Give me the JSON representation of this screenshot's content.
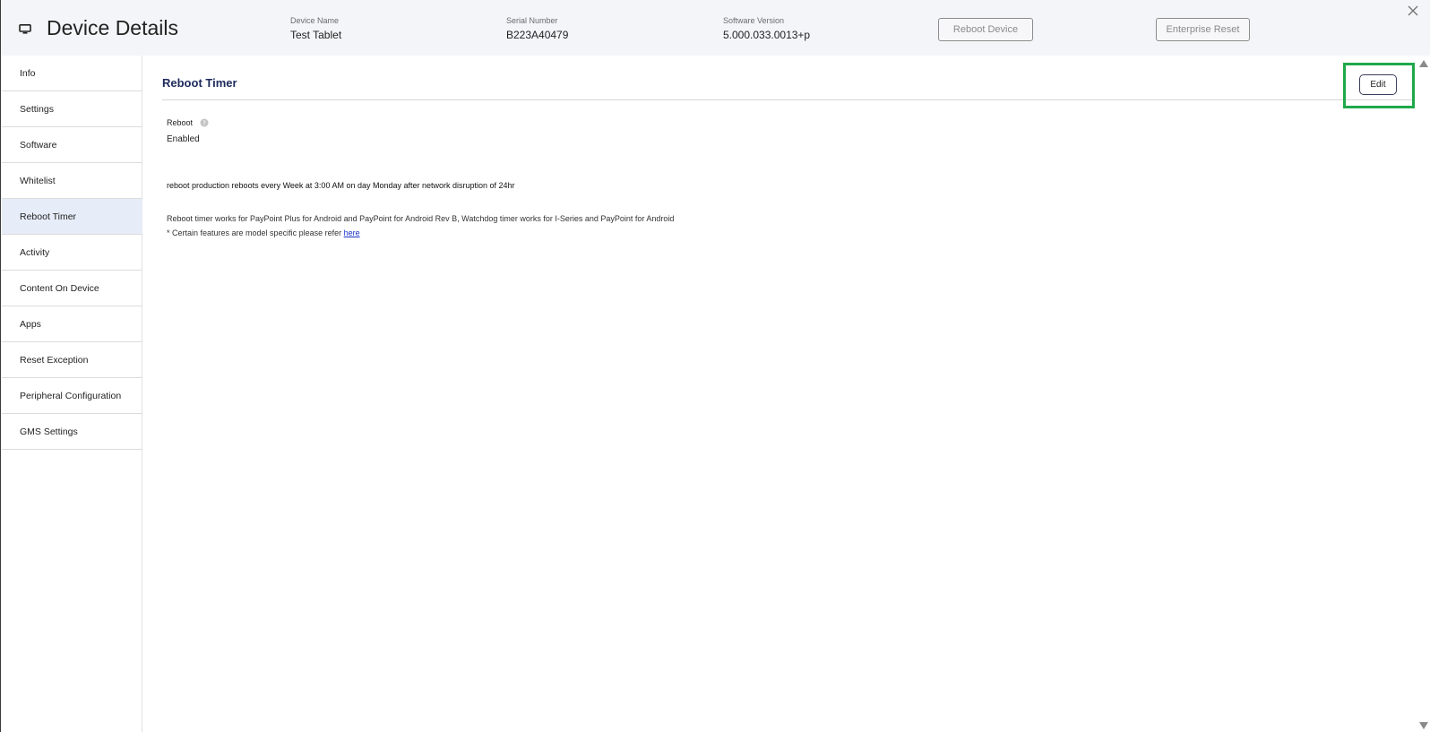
{
  "header": {
    "icon": "monitor-icon",
    "title": "Device Details",
    "device_name_label": "Device Name",
    "device_name": "Test Tablet",
    "serial_label": "Serial Number",
    "serial": "B223A40479",
    "software_label": "Software Version",
    "software": "5.000.033.0013+p",
    "reboot_button": "Reboot Device",
    "enterprise_button": "Enterprise Reset",
    "close_icon": "close-icon"
  },
  "sidebar": {
    "items": [
      {
        "label": "Info"
      },
      {
        "label": "Settings"
      },
      {
        "label": "Software"
      },
      {
        "label": "Whitelist"
      },
      {
        "label": "Reboot Timer",
        "active": true
      },
      {
        "label": "Activity"
      },
      {
        "label": "Content On Device"
      },
      {
        "label": "Apps"
      },
      {
        "label": "Reset Exception"
      },
      {
        "label": "Peripheral Configuration"
      },
      {
        "label": "GMS Settings"
      }
    ]
  },
  "main": {
    "section_title": "Reboot Timer",
    "edit_button": "Edit",
    "reboot_label": "Reboot",
    "help_icon": "question-circle-icon",
    "reboot_value": "Enabled",
    "summary": "reboot production reboots every Week at 3:00 AM on day Monday after network disruption of 24hr",
    "note_compat": "Reboot timer works for PayPoint Plus for Android and PayPoint for Android Rev B, Watchdog timer works for I-Series and PayPoint for Android",
    "note_features_prefix": "* Certain features are model specific please refer ",
    "note_features_link": "here"
  },
  "colors": {
    "header_bg": "#f4f5f8",
    "active_nav_bg": "#e6ecf8",
    "section_title": "#1d2a5c",
    "highlight": "#1fa84a",
    "link": "#1a33cc"
  }
}
